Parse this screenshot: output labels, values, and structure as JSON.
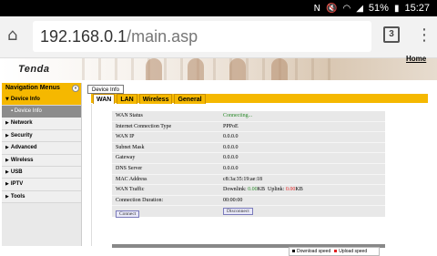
{
  "status_bar": {
    "battery": "51%",
    "time": "15:27",
    "icons": [
      "nfc-icon",
      "mute-icon",
      "wifi-icon",
      "signal-icon",
      "battery-icon"
    ]
  },
  "browser": {
    "url_host": "192.168.0.1",
    "url_path": "/main.asp",
    "tab_count": "3"
  },
  "header": {
    "logo": "Tenda",
    "home_link": "Home"
  },
  "sidebar": {
    "title": "Navigation Menus",
    "toggle": "«",
    "items": [
      {
        "label": "Device Info",
        "expanded": true
      },
      {
        "label": "Network"
      },
      {
        "label": "Security"
      },
      {
        "label": "Advanced"
      },
      {
        "label": "Wireless"
      },
      {
        "label": "USB"
      },
      {
        "label": "IPTV"
      },
      {
        "label": "Tools"
      }
    ],
    "subitem": "Device Info"
  },
  "main": {
    "breadcrumb": "Device Info",
    "tabs": [
      {
        "label": "WAN",
        "active": true
      },
      {
        "label": "LAN"
      },
      {
        "label": "Wireless"
      },
      {
        "label": "General"
      }
    ],
    "rows": [
      {
        "key": "WAN Status",
        "value": "Connecting..."
      },
      {
        "key": "Internet Connection Type",
        "value": "PPPoE"
      },
      {
        "key": "WAN IP",
        "value": "0.0.0.0"
      },
      {
        "key": "Subnet Mask",
        "value": "0.0.0.0"
      },
      {
        "key": "Gateway",
        "value": "0.0.0.0"
      },
      {
        "key": "DNS Server",
        "value": "0.0.0.0"
      },
      {
        "key": "MAC Address",
        "value": "c8:3a:35:19:ae:18"
      }
    ],
    "traffic": {
      "key": "WAN Traffic",
      "down_label": "Downlink:",
      "down_value": "0.00",
      "up_label": "Uplink:",
      "up_value": "0.00",
      "unit": "KB"
    },
    "duration": {
      "key": "Connection Duration:",
      "value": "00:00:00"
    },
    "connect_label": "Connect",
    "disconnect_label": "Disconnect",
    "legend": {
      "download": "Download speed",
      "upload": "Upload speed"
    },
    "colors": {
      "accent": "#f5b800",
      "status_green": "#2a8a2a",
      "traffic_red": "#e02020"
    }
  }
}
